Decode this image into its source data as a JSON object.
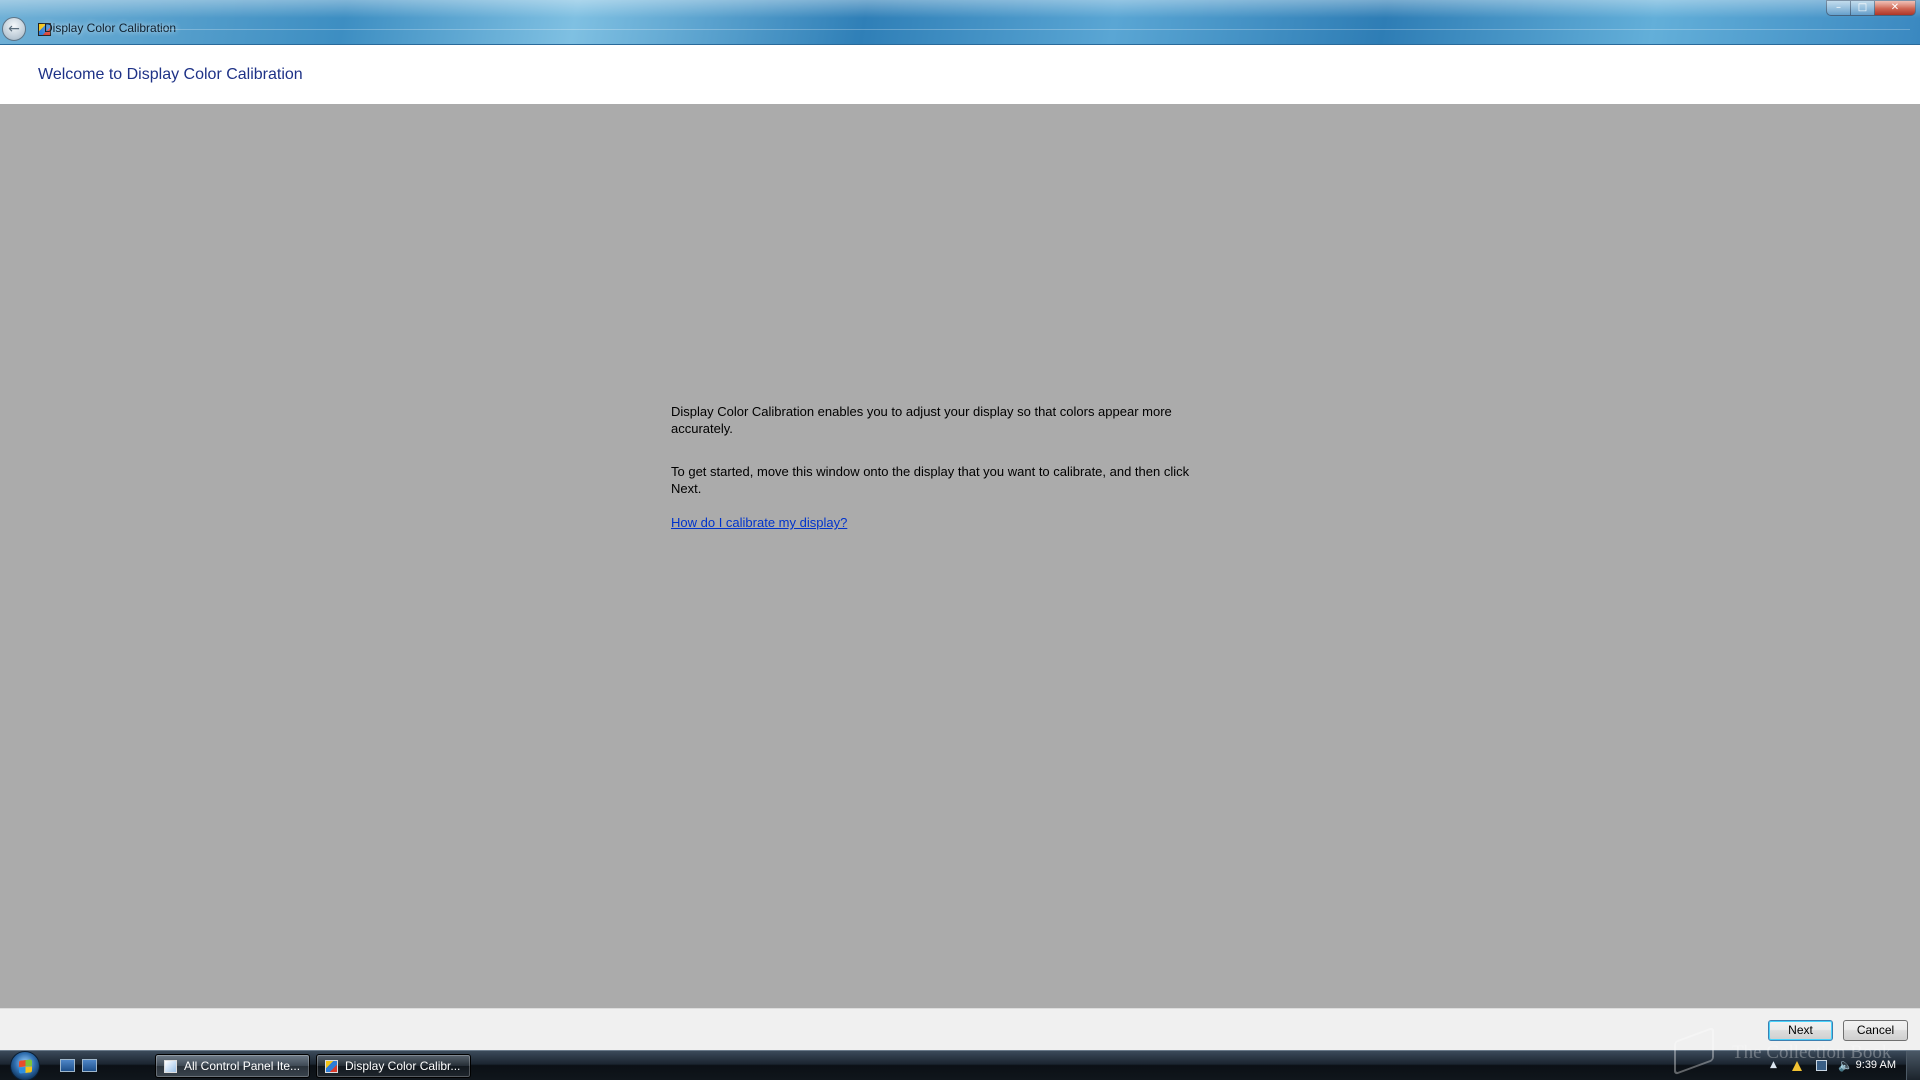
{
  "window": {
    "title": "Display Color Calibration",
    "controls": {
      "minimize": "–",
      "maximize": "□",
      "close": "✕"
    },
    "back_symbol": "←"
  },
  "header": {
    "title": "Welcome to Display Color Calibration"
  },
  "content": {
    "paragraph1": "Display Color Calibration enables you to adjust your display so that colors appear more accurately.",
    "paragraph2": "To get started, move this window onto the display that you want to calibrate, and then click Next.",
    "help_link": "How do I calibrate my display?"
  },
  "footer": {
    "next_label": "Next",
    "cancel_label": "Cancel"
  },
  "taskbar": {
    "items": [
      {
        "label": "All Control Panel Ite...",
        "icon": "control-panel-icon"
      },
      {
        "label": "Display Color Calibr...",
        "icon": "color-calibration-icon"
      }
    ],
    "tray": {
      "chevron": "▲",
      "volume": "🔈"
    },
    "clock": "9:39 AM"
  },
  "watermark": {
    "text": "The Collection Book"
  },
  "colors": {
    "title_text": "#1e3287",
    "content_bg": "#ababab",
    "link": "#0033cc",
    "footer_bg": "#f0f0f0"
  }
}
